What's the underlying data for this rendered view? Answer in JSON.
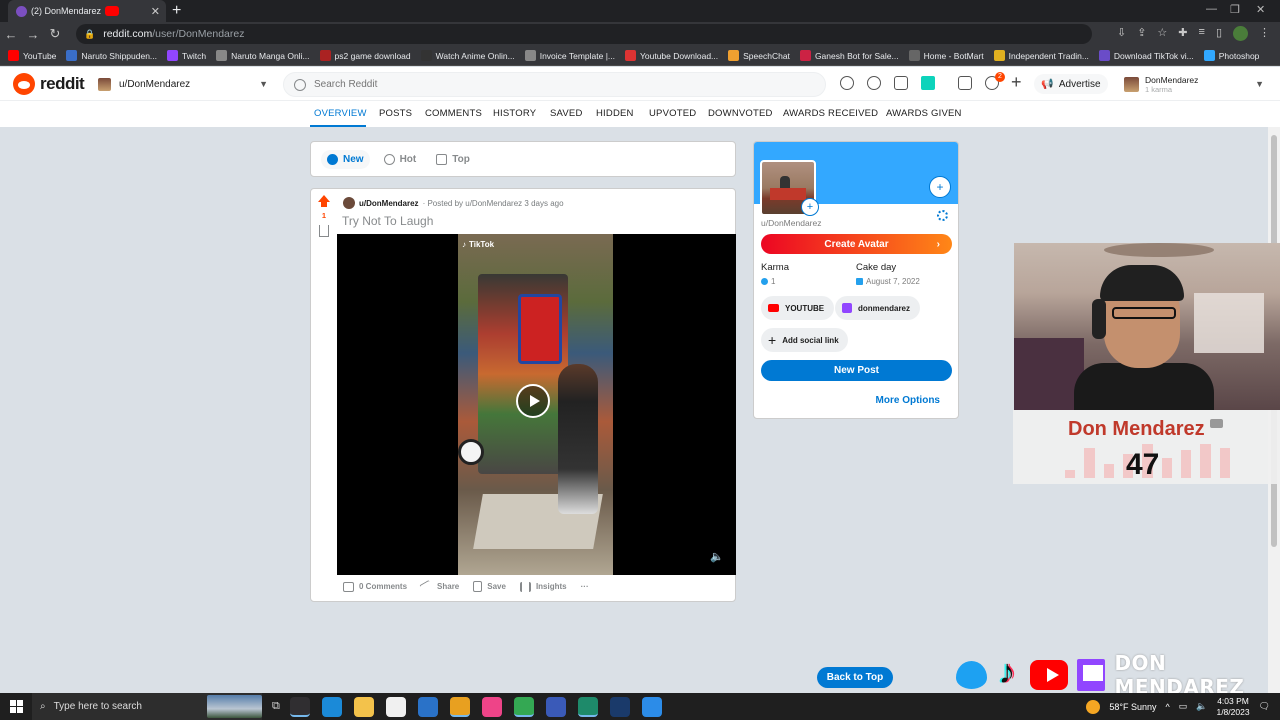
{
  "browser": {
    "tab_title": "(2) DonMendarez",
    "url_host": "reddit.com",
    "url_path": "/user/DonMendarez",
    "bookmarks": [
      {
        "label": "YouTube",
        "color": "#ff0000"
      },
      {
        "label": "Naruto Shippuden...",
        "color": "#3a6ec8"
      },
      {
        "label": "Twitch",
        "color": "#9146ff"
      },
      {
        "label": "Naruto Manga Onli...",
        "color": "#888888"
      },
      {
        "label": "ps2 game download",
        "color": "#aa2222"
      },
      {
        "label": "Watch Anime Onlin...",
        "color": "#333333"
      },
      {
        "label": "Invoice Template |...",
        "color": "#888888"
      },
      {
        "label": "Youtube Download...",
        "color": "#dd3333"
      },
      {
        "label": "SpeechChat",
        "color": "#f0a030"
      },
      {
        "label": "Ganesh Bot for Sale...",
        "color": "#cc2244"
      },
      {
        "label": "Home - BotMart",
        "color": "#666666"
      },
      {
        "label": "Independent Tradin...",
        "color": "#e0b020"
      },
      {
        "label": "Download TikTok vi...",
        "color": "#6a4cc8"
      },
      {
        "label": "Photoshop",
        "color": "#31a8ff"
      }
    ]
  },
  "header": {
    "wordmark": "reddit",
    "community": "u/DonMendarez",
    "search_placeholder": "Search Reddit",
    "notification_count": "2",
    "advertise_label": "Advertise",
    "username": "DonMendarez",
    "karma_text": "1 karma"
  },
  "profile_nav": {
    "items": [
      "OVERVIEW",
      "POSTS",
      "COMMENTS",
      "HISTORY",
      "SAVED",
      "HIDDEN",
      "UPVOTED",
      "DOWNVOTED",
      "AWARDS RECEIVED",
      "AWARDS GIVEN"
    ],
    "active": "OVERVIEW"
  },
  "sort": {
    "new": "New",
    "hot": "Hot",
    "top": "Top"
  },
  "post": {
    "score": "1",
    "user": "u/DonMendarez",
    "posted_by": "· Posted by u/DonMendarez 3 days ago",
    "title": "Try Not To Laugh",
    "video_watermark": "TikTok",
    "actions": {
      "comments": "0 Comments",
      "share": "Share",
      "save": "Save",
      "insights": "Insights",
      "more": "···"
    }
  },
  "profile_card": {
    "username": "u/DonMendarez",
    "create_avatar": "Create Avatar",
    "karma_label": "Karma",
    "karma_value": "1",
    "cakeday_label": "Cake day",
    "cakeday_value": "August 7, 2022",
    "social_links": [
      "YOUTUBE",
      "donmendarez"
    ],
    "add_social": "Add social link",
    "new_post": "New Post",
    "more_options": "More Options"
  },
  "back_to_top": "Back to Top",
  "stream_overlay": {
    "streamer_name": "Don Mendarez",
    "sub_count": "47",
    "brand_name": "DON MENDAREZ"
  },
  "taskbar": {
    "search_placeholder": "Type here to search",
    "weather": "58°F  Sunny",
    "time": "4:03 PM",
    "date": "1/8/2023",
    "apps": [
      {
        "name": "obs",
        "color": "#302e31"
      },
      {
        "name": "edge",
        "color": "#1b8ad8"
      },
      {
        "name": "explorer",
        "color": "#f3c24b"
      },
      {
        "name": "store",
        "color": "#f0f0f0"
      },
      {
        "name": "mail",
        "color": "#2a72c8"
      },
      {
        "name": "chrome",
        "color": "#e8a020"
      },
      {
        "name": "itunes",
        "color": "#ee4488"
      },
      {
        "name": "chrome-2",
        "color": "#34a853"
      },
      {
        "name": "app-blue",
        "color": "#3a5ab8"
      },
      {
        "name": "app-teal",
        "color": "#1e8a6a"
      },
      {
        "name": "vegas",
        "color": "#1a3a6a"
      },
      {
        "name": "app-light-blue",
        "color": "#2c8ce8"
      }
    ]
  }
}
